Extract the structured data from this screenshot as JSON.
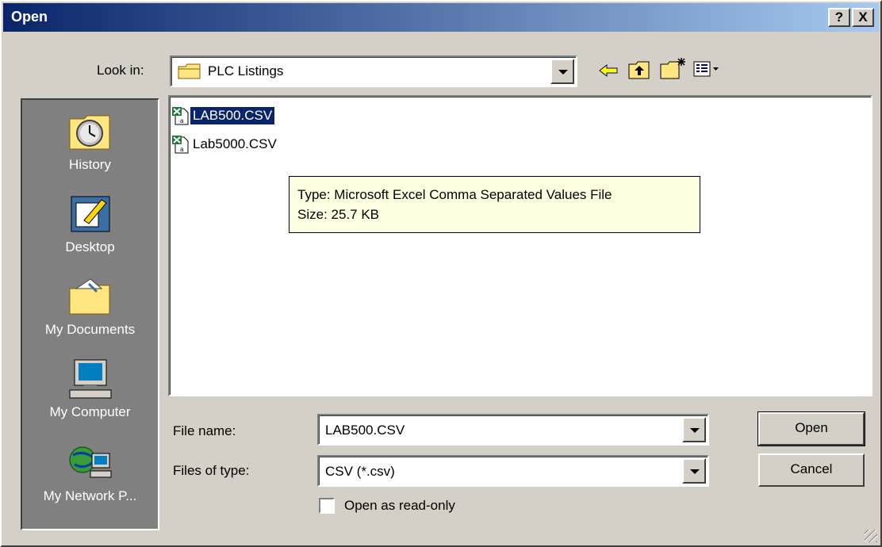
{
  "window": {
    "title": "Open"
  },
  "titlebar": {
    "help_label": "?",
    "close_label": "X"
  },
  "look_in": {
    "label": "Look in:",
    "value": "PLC Listings"
  },
  "toolbar": {
    "icons": [
      "back-arrow-icon",
      "up-folder-icon",
      "new-folder-icon",
      "view-menu-icon"
    ]
  },
  "places_bar": {
    "items": [
      {
        "label": "History",
        "icon": "history-icon"
      },
      {
        "label": "Desktop",
        "icon": "desktop-icon"
      },
      {
        "label": "My Documents",
        "icon": "my-documents-icon"
      },
      {
        "label": "My Computer",
        "icon": "my-computer-icon"
      },
      {
        "label": "My Network P...",
        "icon": "network-places-icon"
      }
    ]
  },
  "files": [
    {
      "name": "LAB500.CSV",
      "selected": true
    },
    {
      "name": "Lab5000.CSV",
      "selected": false
    }
  ],
  "tooltip": {
    "type_line": "Type: Microsoft Excel Comma Separated Values File",
    "size_line": "Size: 25.7 KB"
  },
  "file_name": {
    "label": "File name:",
    "value": "LAB500.CSV"
  },
  "files_of_type": {
    "label": "Files of type:",
    "value": "CSV (*.csv)"
  },
  "read_only": {
    "label": "Open as read-only",
    "checked": false
  },
  "buttons": {
    "open": "Open",
    "cancel": "Cancel"
  },
  "colors": {
    "title_start": "#0a246a",
    "title_end": "#a6caf0",
    "selection": "#0a246a",
    "tooltip_bg": "#ffffe1",
    "face": "#d4d0c8"
  }
}
